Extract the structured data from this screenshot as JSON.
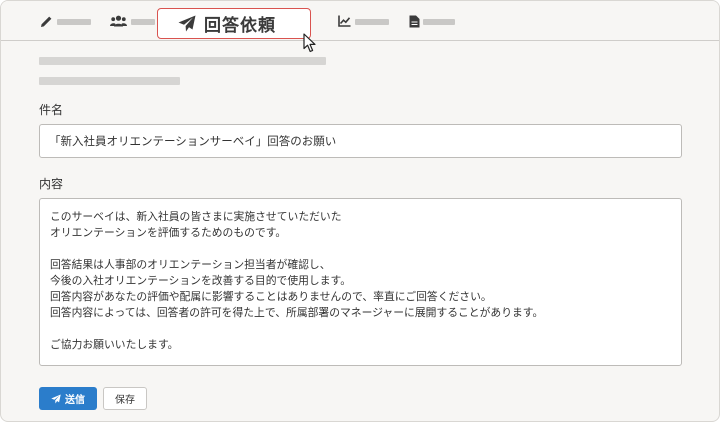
{
  "tabs": [
    {
      "icon": "pencil-icon"
    },
    {
      "icon": "users-icon"
    },
    {
      "icon": "paper-plane-icon",
      "label": "回答依頼",
      "active": true
    },
    {
      "icon": "line-chart-icon"
    },
    {
      "icon": "document-icon"
    }
  ],
  "form": {
    "subject_label": "件名",
    "subject_value": "「新入社員オリエンテーションサーベイ」回答のお願い",
    "body_label": "内容",
    "body_value": "このサーベイは、新入社員の皆さまに実施させていただいた\nオリエンテーションを評価するためのものです。\n\n回答結果は人事部のオリエンテーション担当者が確認し、\n今後の入社オリエンテーションを改善する目的で使用します。\n回答内容があなたの評価や配属に影響することはありませんので、率直にご回答ください。\n回答内容によっては、回答者の許可を得た上で、所属部署のマネージャーに展開することがあります。\n\nご協力お願いいたします。"
  },
  "buttons": {
    "send_label": "送信",
    "save_label": "保存"
  },
  "colors": {
    "accent": "#2b7dcb",
    "highlight_border": "#d9534f",
    "placeholder": "#c9c8c6"
  }
}
